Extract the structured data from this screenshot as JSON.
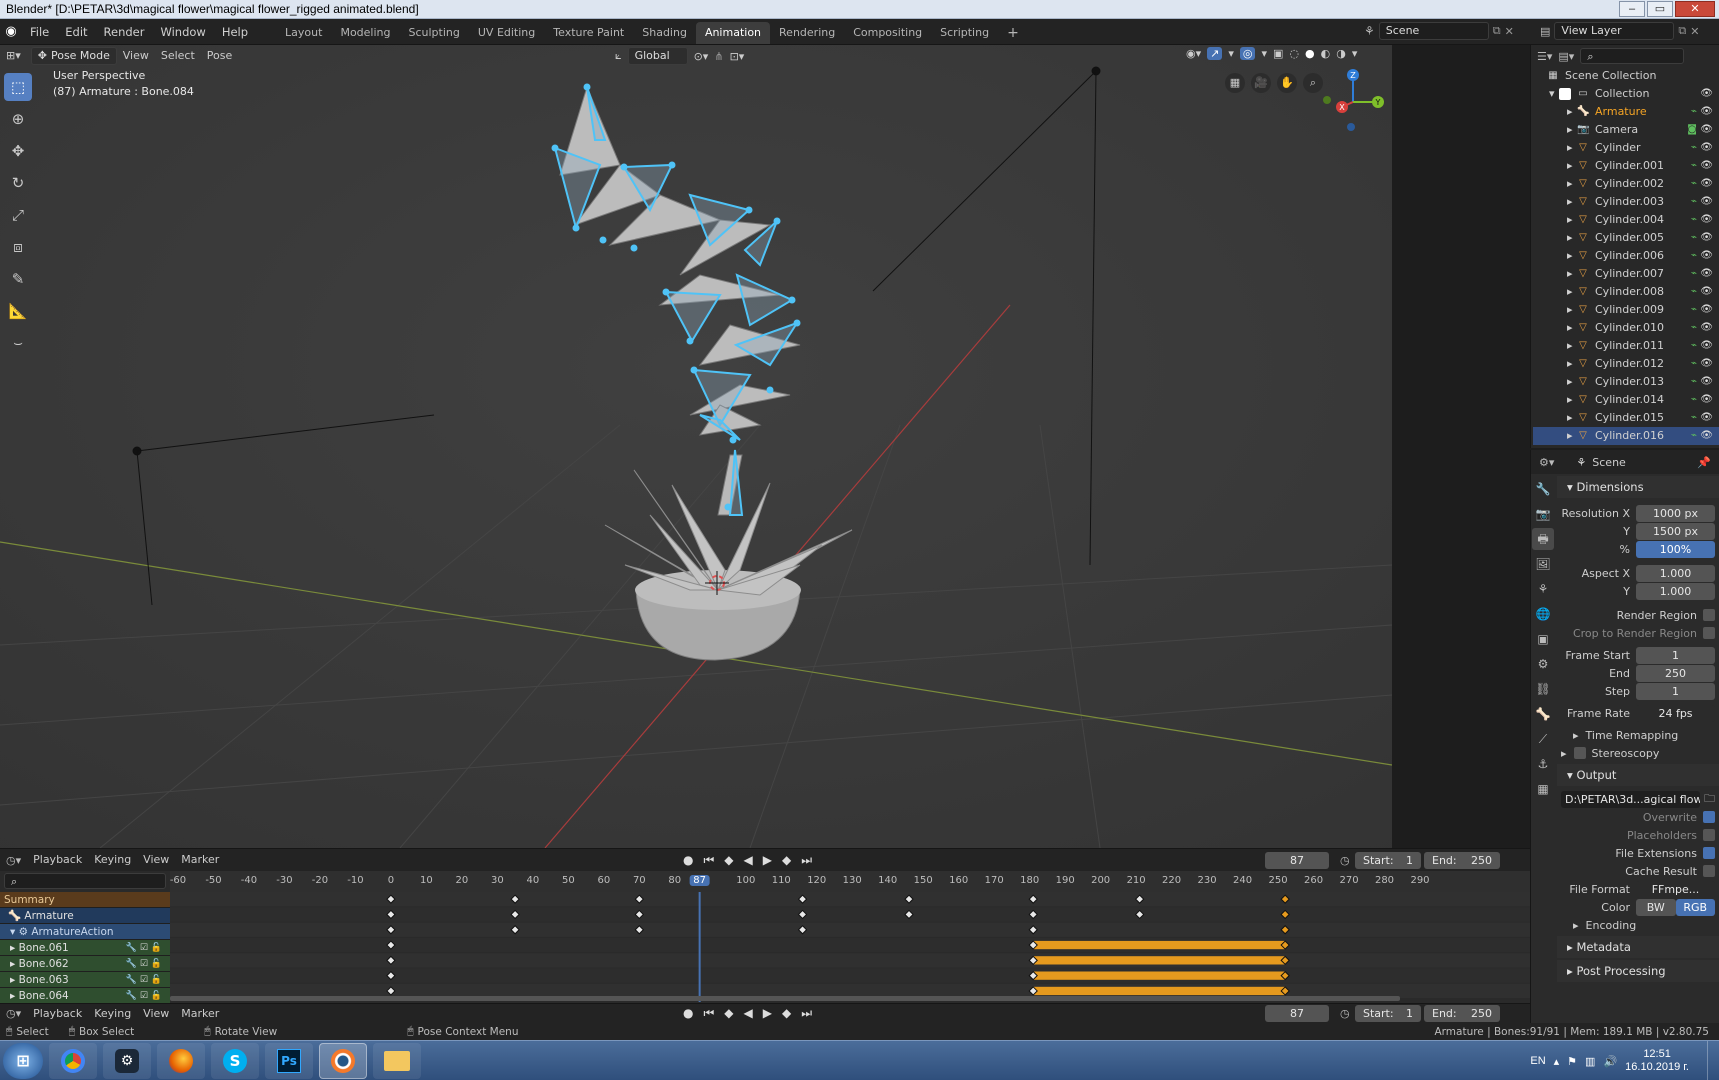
{
  "window": {
    "title": "Blender* [D:\\PETAR\\3d\\magical flower\\magical flower_rigged animated.blend]",
    "buttons": [
      "‒",
      "▭",
      "✕"
    ]
  },
  "menu": [
    "File",
    "Edit",
    "Render",
    "Window",
    "Help"
  ],
  "workspaces": [
    {
      "label": "Layout"
    },
    {
      "label": "Modeling"
    },
    {
      "label": "Sculpting"
    },
    {
      "label": "UV Editing"
    },
    {
      "label": "Texture Paint"
    },
    {
      "label": "Shading"
    },
    {
      "label": "Animation",
      "active": true
    },
    {
      "label": "Rendering"
    },
    {
      "label": "Compositing"
    },
    {
      "label": "Scripting"
    }
  ],
  "scene_field": "Scene",
  "view_layer_field": "View Layer",
  "viewport": {
    "mode": "Pose Mode",
    "menus": [
      "View",
      "Select",
      "Pose"
    ],
    "orientation": "Global",
    "overlay_title": "User Perspective",
    "overlay_subtitle": "(87) Armature : Bone.084",
    "gizmo": {
      "z": "Z",
      "y": "Y",
      "x": "X"
    }
  },
  "outliner": {
    "search_placeholder": "",
    "root": "Scene Collection",
    "collection": "Collection",
    "items": [
      {
        "label": "Armature",
        "type": "armature",
        "active": true
      },
      {
        "label": "Camera",
        "type": "camera"
      },
      {
        "label": "Cylinder",
        "type": "mesh"
      },
      {
        "label": "Cylinder.001",
        "type": "mesh"
      },
      {
        "label": "Cylinder.002",
        "type": "mesh"
      },
      {
        "label": "Cylinder.003",
        "type": "mesh"
      },
      {
        "label": "Cylinder.004",
        "type": "mesh"
      },
      {
        "label": "Cylinder.005",
        "type": "mesh"
      },
      {
        "label": "Cylinder.006",
        "type": "mesh"
      },
      {
        "label": "Cylinder.007",
        "type": "mesh"
      },
      {
        "label": "Cylinder.008",
        "type": "mesh"
      },
      {
        "label": "Cylinder.009",
        "type": "mesh"
      },
      {
        "label": "Cylinder.010",
        "type": "mesh"
      },
      {
        "label": "Cylinder.011",
        "type": "mesh"
      },
      {
        "label": "Cylinder.012",
        "type": "mesh"
      },
      {
        "label": "Cylinder.013",
        "type": "mesh"
      },
      {
        "label": "Cylinder.014",
        "type": "mesh"
      },
      {
        "label": "Cylinder.015",
        "type": "mesh"
      },
      {
        "label": "Cylinder.016",
        "type": "mesh",
        "selected": true
      }
    ]
  },
  "properties": {
    "context": "Scene",
    "dimensions": {
      "title": "Dimensions",
      "resolution_x_label": "Resolution X",
      "resolution_x": "1000 px",
      "resolution_y_label": "Y",
      "resolution_y": "1500 px",
      "percent_label": "%",
      "percent": "100%",
      "aspect_x_label": "Aspect X",
      "aspect_x": "1.000",
      "aspect_y_label": "Y",
      "aspect_y": "1.000",
      "render_region": "Render Region",
      "crop_region": "Crop to Render Region",
      "frame_start_label": "Frame Start",
      "frame_start": "1",
      "end_label": "End",
      "end": "250",
      "step_label": "Step",
      "step": "1",
      "frame_rate_label": "Frame Rate",
      "frame_rate": "24 fps",
      "time_remapping": "Time Remapping",
      "stereoscopy": "Stereoscopy"
    },
    "output": {
      "title": "Output",
      "path": "D:\\PETAR\\3d...agical flower",
      "overwrite": "Overwrite",
      "placeholders": "Placeholders",
      "file_extensions": "File Extensions",
      "cache_result": "Cache Result",
      "file_format_label": "File Format",
      "file_format": "FFmpe...",
      "color_label": "Color",
      "color_bw": "BW",
      "color_rgb": "RGB",
      "encoding": "Encoding"
    },
    "metadata": "Metadata",
    "post_processing": "Post Processing"
  },
  "dopesheet": {
    "menus": [
      "Playback",
      "Keying",
      "View",
      "Marker"
    ],
    "current_frame": "87",
    "start_label": "Start:",
    "start": "1",
    "end_label": "End:",
    "end": "250",
    "ruler_ticks": [
      "-60",
      "-50",
      "-40",
      "-30",
      "-20",
      "-10",
      "0",
      "10",
      "20",
      "30",
      "40",
      "50",
      "60",
      "70",
      "80",
      "87",
      "100",
      "110",
      "120",
      "130",
      "140",
      "150",
      "160",
      "170",
      "180",
      "190",
      "200",
      "210",
      "220",
      "230",
      "240",
      "250",
      "260",
      "270",
      "280",
      "290"
    ],
    "channels": [
      {
        "label": "Summary",
        "kind": "summary"
      },
      {
        "label": "Armature",
        "kind": "object"
      },
      {
        "label": "ArmatureAction",
        "kind": "action"
      },
      {
        "label": "Bone.061",
        "kind": "bone"
      },
      {
        "label": "Bone.062",
        "kind": "bone"
      },
      {
        "label": "Bone.063",
        "kind": "bone"
      },
      {
        "label": "Bone.064",
        "kind": "bone"
      }
    ],
    "keyframes_summary": [
      0,
      35,
      70,
      116,
      146,
      181,
      211,
      252
    ],
    "keyframes_bones": [
      0,
      181,
      252
    ]
  },
  "timeline": {
    "menus": [
      "Playback",
      "Keying",
      "View",
      "Marker"
    ],
    "current_frame": "87",
    "start_label": "Start:",
    "start": "1",
    "end_label": "End:",
    "end": "250"
  },
  "statusbar": {
    "select": "Select",
    "box_select": "Box Select",
    "rotate_view": "Rotate View",
    "context_menu": "Pose Context Menu",
    "stats": "Armature | Bones:91/91 | Mem: 189.1 MB | v2.80.75"
  },
  "taskbar": {
    "apps": [
      "chrome",
      "steam",
      "firefox",
      "skype",
      "photoshop",
      "blender",
      "explorer"
    ],
    "ps_label": "Ps",
    "language": "EN",
    "time": "12:51",
    "date": "16.10.2019 г."
  },
  "colors": {
    "accent": "#4772b3",
    "keyframe_orange": "#e69a1e",
    "bone_blue": "#4fc3f7",
    "active_object": "#f4a425"
  }
}
